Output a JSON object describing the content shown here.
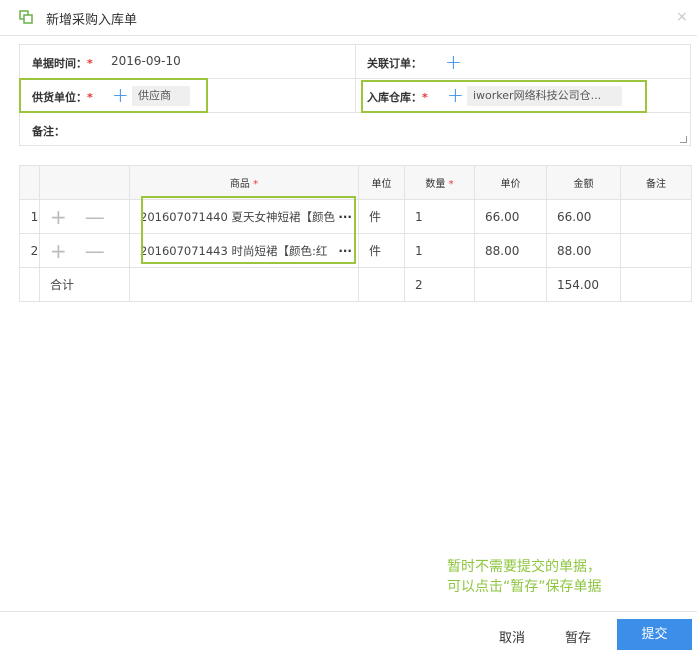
{
  "dialog": {
    "title": "新增采购入库单",
    "close": "×"
  },
  "form": {
    "date_label": "单据时间：",
    "date_value": "2016-09-10",
    "order_label": "关联订单：",
    "supplier_label": "供货单位：",
    "supplier_value": "供应商",
    "warehouse_label": "入库仓库：",
    "warehouse_value": "iworker网络科技公司仓...",
    "note_label": "备注：",
    "required_mark": "*",
    "plus": "+"
  },
  "table": {
    "headers": [
      "",
      "",
      "商品",
      "单位",
      "数量",
      "单价",
      "金额",
      "备注"
    ],
    "required_mark": "*",
    "actions": {
      "add": "+",
      "remove": "—",
      "more": "···"
    },
    "rows": [
      {
        "index": "1",
        "product": "201607071440 夏天女神短裙【颜色",
        "unit": "件",
        "qty": "1",
        "price": "66.00",
        "amount": "66.00",
        "note": ""
      },
      {
        "index": "2",
        "product": "201607071443 时尚短裙【颜色:红",
        "unit": "件",
        "qty": "1",
        "price": "88.00",
        "amount": "88.00",
        "note": ""
      }
    ],
    "total": {
      "label": "合计",
      "qty": "2",
      "amount": "154.00"
    }
  },
  "tip": {
    "line1": "暂时不需要提交的单据，",
    "line2": "可以点击“暂存”保存单据"
  },
  "footer": {
    "cancel": "取消",
    "save_draft": "暂存",
    "submit": "提交"
  },
  "colors": {
    "accent": "#3c8ee8",
    "highlight": "#9bc53d",
    "required": "#e33333",
    "tip": "#8ec63f"
  }
}
